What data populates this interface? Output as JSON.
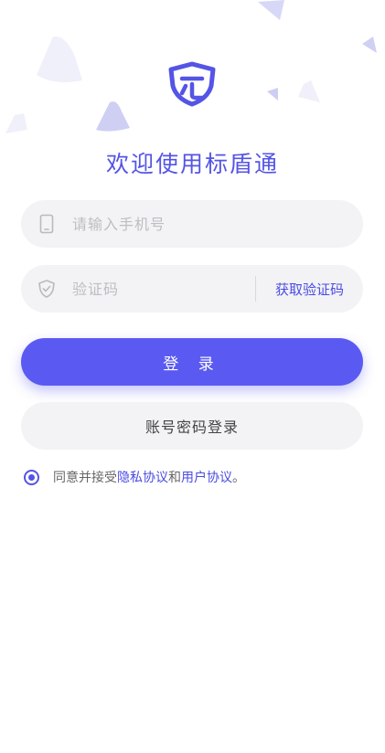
{
  "brand": {
    "title": "欢迎使用标盾通",
    "accent_color": "#5454e6",
    "logo_icon": "shield-logo-icon"
  },
  "form": {
    "phone": {
      "icon": "phone-icon",
      "placeholder": "请输入手机号",
      "value": ""
    },
    "code": {
      "icon": "shield-check-icon",
      "placeholder": "验证码",
      "value": "",
      "get_code_label": "获取验证码"
    }
  },
  "actions": {
    "login_label": "登 录",
    "password_login_label": "账号密码登录"
  },
  "agreement": {
    "checked": true,
    "prefix": "同意并接受",
    "privacy_link": "隐私协议",
    "and": "和",
    "user_link": "用户协议",
    "suffix": "。"
  }
}
